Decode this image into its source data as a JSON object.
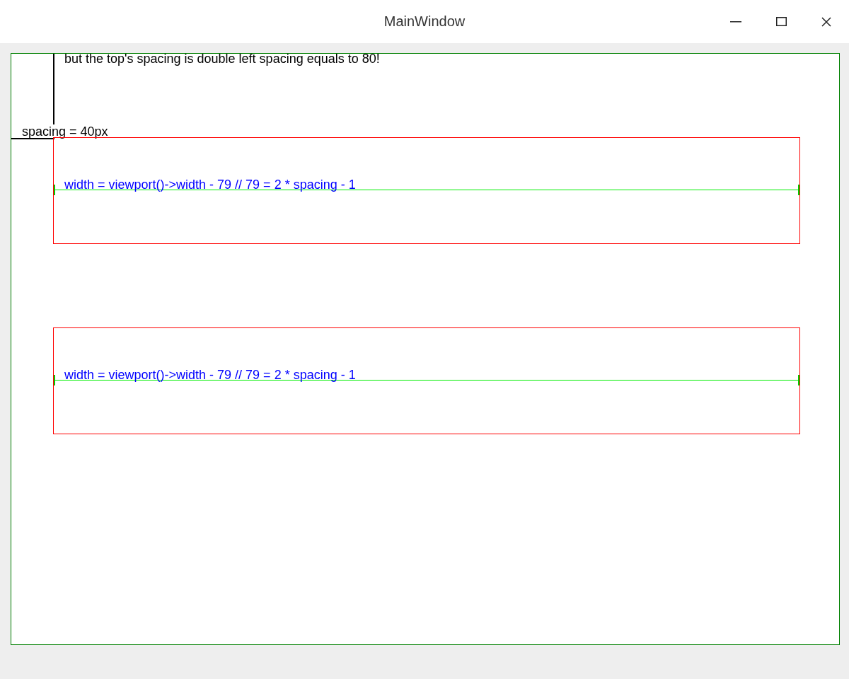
{
  "window": {
    "title": "MainWindow"
  },
  "top_note": "but the top's spacing is double left spacing equals to 80!",
  "spacing_label": "spacing = 40px",
  "boxes": [
    {
      "label": "width = viewport()->width - 79 // 79 = 2 * spacing - 1"
    },
    {
      "label": "width = viewport()->width - 79 // 79 = 2 * spacing - 1"
    }
  ]
}
